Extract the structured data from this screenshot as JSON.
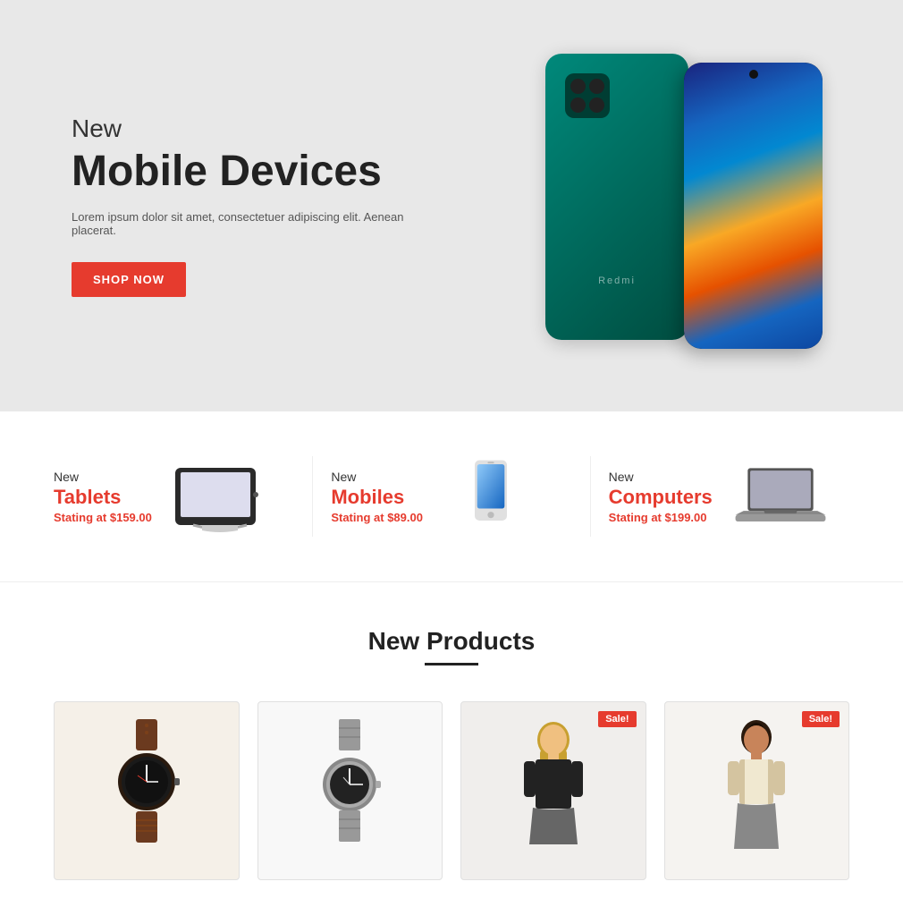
{
  "hero": {
    "new_label": "New",
    "title": "Mobile Devices",
    "description": "Lorem ipsum dolor sit amet, consectetuer adipiscing elit. Aenean placerat.",
    "button_label": "SHOP NOW",
    "phone_brand": "Redmi"
  },
  "categories": [
    {
      "id": "tablets",
      "new_label": "New",
      "name": "Tablets",
      "price_label": "Stating at",
      "price": "$159.00"
    },
    {
      "id": "mobiles",
      "new_label": "New",
      "name": "Mobiles",
      "price_label": "Stating at",
      "price": "$89.00"
    },
    {
      "id": "computers",
      "new_label": "New",
      "name": "Computers",
      "price_label": "Stating at",
      "price": "$199.00"
    }
  ],
  "new_products": {
    "section_title": "New Products",
    "products": [
      {
        "id": "watch1",
        "sale": false,
        "type": "watch-brown"
      },
      {
        "id": "watch2",
        "sale": false,
        "type": "watch-silver"
      },
      {
        "id": "person1",
        "sale": true,
        "type": "person-blonde"
      },
      {
        "id": "person2",
        "sale": true,
        "type": "person-dark"
      }
    ]
  },
  "labels": {
    "sale": "Sale!"
  }
}
